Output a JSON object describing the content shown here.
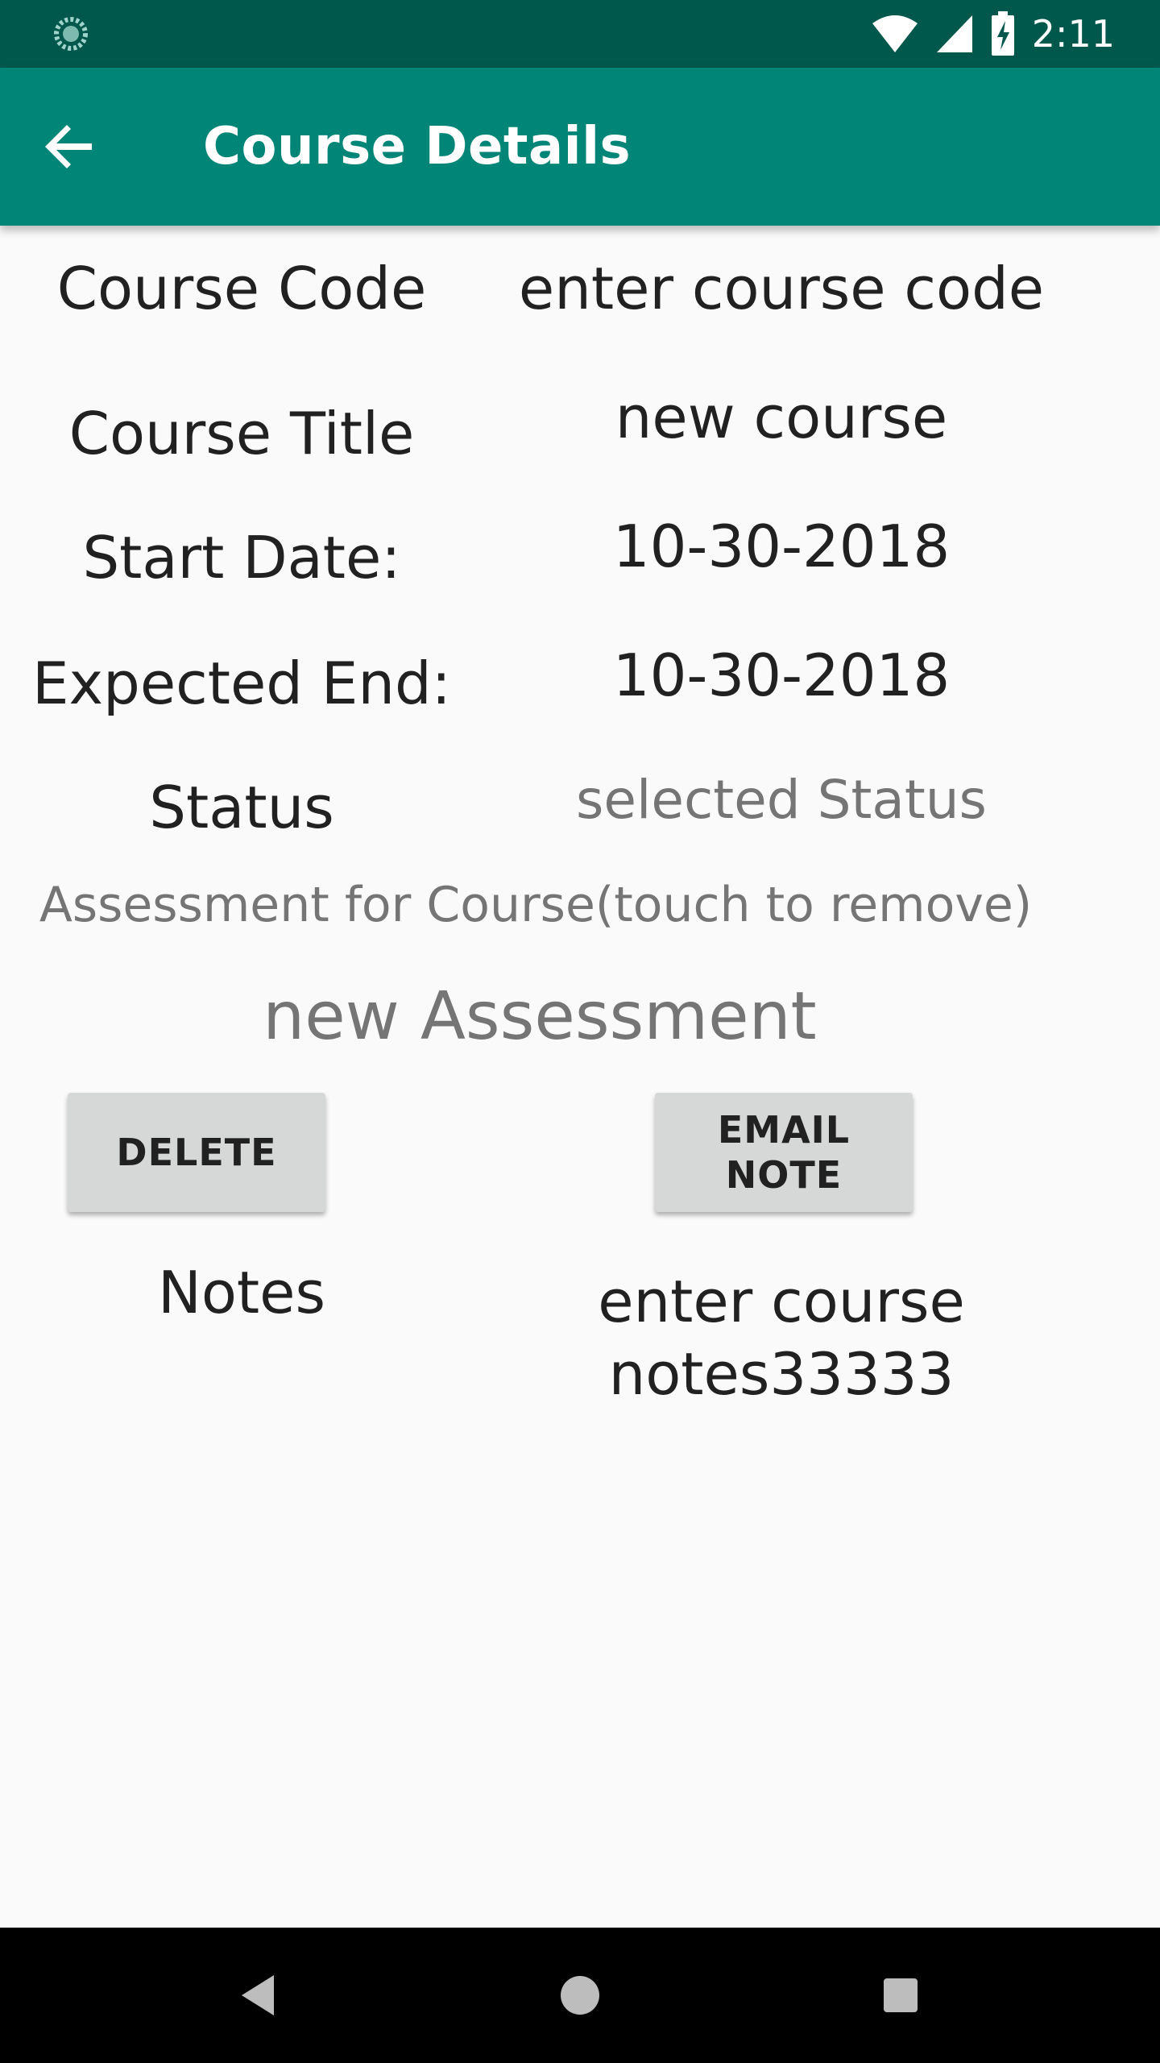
{
  "status_bar": {
    "time": "2:11",
    "icons": [
      "sync-icon",
      "wifi-icon",
      "signal-icon",
      "battery-charging-icon"
    ]
  },
  "app_bar": {
    "title": "Course Details",
    "back_icon": "back-arrow-icon"
  },
  "form": {
    "course_code": {
      "label": "Course Code",
      "value": "enter course code"
    },
    "course_title": {
      "label": "Course Title",
      "value": "new course"
    },
    "start_date": {
      "label": "Start Date:",
      "value": "10-30-2018"
    },
    "expected_end": {
      "label": "Expected End:",
      "value": "10-30-2018"
    },
    "status": {
      "label": "Status",
      "value": "selected Status"
    }
  },
  "assessments": {
    "header": "Assessment for Course(touch to remove)",
    "items": [
      "new Assessment"
    ]
  },
  "buttons": {
    "delete": "DELETE",
    "email_note": "EMAIL NOTE"
  },
  "notes": {
    "label": "Notes",
    "value": "enter course notes33333"
  },
  "nav_bar": {
    "icons": [
      "back-triangle-icon",
      "home-circle-icon",
      "recents-square-icon"
    ]
  },
  "colors": {
    "status_bar": "#00574b",
    "app_bar": "#008577",
    "background": "#fafafa",
    "button": "#d6d7d7"
  }
}
